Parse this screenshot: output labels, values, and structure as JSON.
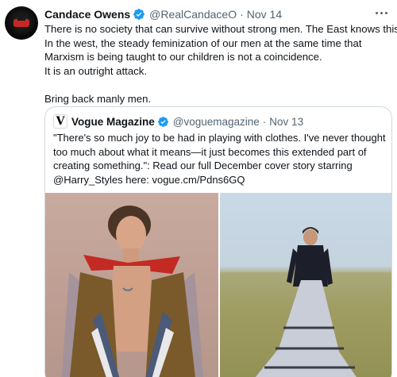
{
  "tweet": {
    "author_name": "Candace Owens",
    "handle": "@RealCandaceO",
    "separator": "·",
    "date": "Nov 14",
    "lines": [
      "There is no society that can survive without strong men. The East knows this.",
      "In the west, the steady feminization of our men at the same time that",
      "Marxism is being taught to our children is not a coincidence.",
      "It is an outright attack."
    ],
    "closing": "Bring back manly men."
  },
  "quoted_tweet": {
    "logo_letter": "V",
    "author_name": "Vogue Magazine",
    "handle": "@voguemagazine",
    "separator": "·",
    "date": "Nov 13",
    "lines": [
      "\"There's so much joy to be had in playing with clothes. I've never thought",
      "too much about what it means—it just becomes this extended part of",
      "creating something.\": Read our full December cover story starring",
      "@Harry_Styles here: vogue.cm/Pdns6GQ"
    ]
  },
  "colors": {
    "verified_blue": "#1d9bf0",
    "muted_text": "#536471",
    "border": "#cfd9de"
  },
  "icons": [
    "verified-badge-icon",
    "more-options-icon",
    "vogue-logo-icon"
  ]
}
